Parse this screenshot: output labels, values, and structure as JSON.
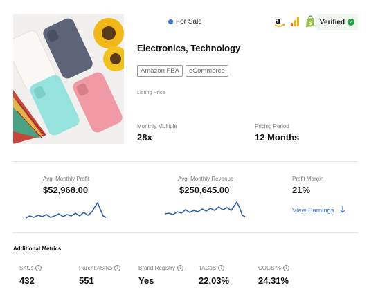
{
  "listing": {
    "status": "For Sale",
    "verified_label": "Verified",
    "title": "Electronics, Technology",
    "tags": [
      "Amazon FBA",
      "eCommerce"
    ],
    "listing_price_label": "Listing Price",
    "monthly_multiple_label": "Monthly Multiple",
    "monthly_multiple_value": "28x",
    "pricing_period_label": "Pricing Period",
    "pricing_period_value": "12 Months"
  },
  "platforms": [
    "amazon-icon",
    "google-analytics-icon",
    "shopify-icon"
  ],
  "stats": {
    "profit_label": "Avg. Monthly Profit",
    "profit_value": "$52,968.00",
    "revenue_label": "Avg. Monthly Revenue",
    "revenue_value": "$250,645.00",
    "margin_label": "Profit Margin",
    "margin_value": "21%",
    "view_earnings_label": "View Earnings"
  },
  "additional": {
    "title": "Additional Metrics",
    "items": [
      {
        "label": "SKUs",
        "value": "432"
      },
      {
        "label": "Parent ASINs",
        "value": "551"
      },
      {
        "label": "Brand Registry",
        "value": "Yes"
      },
      {
        "label": "TACoS",
        "value": "22.03%"
      },
      {
        "label": "COGS %",
        "value": "24.31%"
      }
    ]
  },
  "colors": {
    "accent": "#3a76d6",
    "spark_line": "#2e5fa8",
    "verified_bg": "#eef6ee",
    "verified_check": "#27a04a"
  }
}
